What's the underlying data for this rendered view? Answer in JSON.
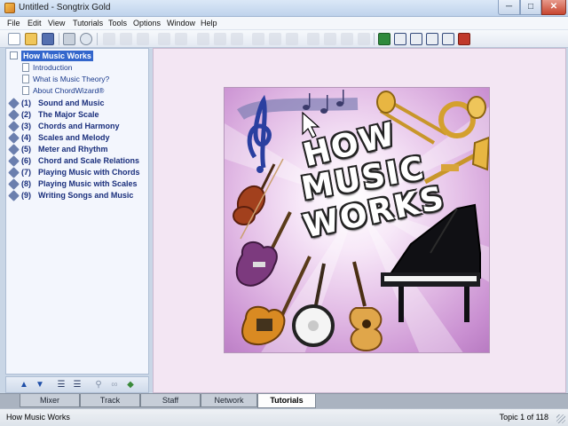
{
  "window": {
    "title": "Untitled - Songtrix Gold",
    "minimize_glyph": "─",
    "maximize_glyph": "□",
    "close_glyph": "✕"
  },
  "menu": [
    "File",
    "Edit",
    "View",
    "Tutorials",
    "Tools",
    "Options",
    "Window",
    "Help"
  ],
  "toolbar": {
    "icons": [
      "new-icon",
      "open-icon",
      "save-icon",
      "print-icon",
      "print-preview-icon",
      "cut-icon",
      "copy-icon",
      "paste-icon",
      "undo-icon",
      "redo-icon",
      "play-icon",
      "record-icon",
      "metronome-icon",
      "view-score-icon",
      "view-grid-icon",
      "notes-icon",
      "chords-icon",
      "track-icon",
      "scales-icon"
    ]
  },
  "tree": {
    "root": "How Music Works",
    "pages": [
      "Introduction",
      "What is Music Theory?",
      "About ChordWizard®"
    ],
    "chapters": [
      {
        "num": "(1)",
        "label": "Sound and Music"
      },
      {
        "num": "(2)",
        "label": "The Major Scale"
      },
      {
        "num": "(3)",
        "label": "Chords and Harmony"
      },
      {
        "num": "(4)",
        "label": "Scales and Melody"
      },
      {
        "num": "(5)",
        "label": "Meter and Rhythm"
      },
      {
        "num": "(6)",
        "label": "Chord and Scale Relations"
      },
      {
        "num": "(7)",
        "label": "Playing Music with Chords"
      },
      {
        "num": "(8)",
        "label": "Playing Music with Scales"
      },
      {
        "num": "(9)",
        "label": "Writing Songs and Music"
      }
    ]
  },
  "nav_strip": {
    "icons": [
      "arrow-up-icon",
      "arrow-down-icon",
      "collapse-icon",
      "expand-icon",
      "search-icon",
      "link-icon",
      "bookmark-icon"
    ]
  },
  "cover": {
    "line1": "HOW",
    "line2": "MUSIC",
    "line3": "WORKS"
  },
  "tabs": {
    "items": [
      "Mixer",
      "Track",
      "Staff",
      "Network",
      "Tutorials"
    ],
    "active": "Tutorials"
  },
  "status": {
    "left": "How Music Works",
    "right": "Topic 1 of 118"
  },
  "colors": {
    "selection": "#3366cc",
    "tree_text": "#1a2f7c",
    "cover_pink": "#e3bde6"
  }
}
